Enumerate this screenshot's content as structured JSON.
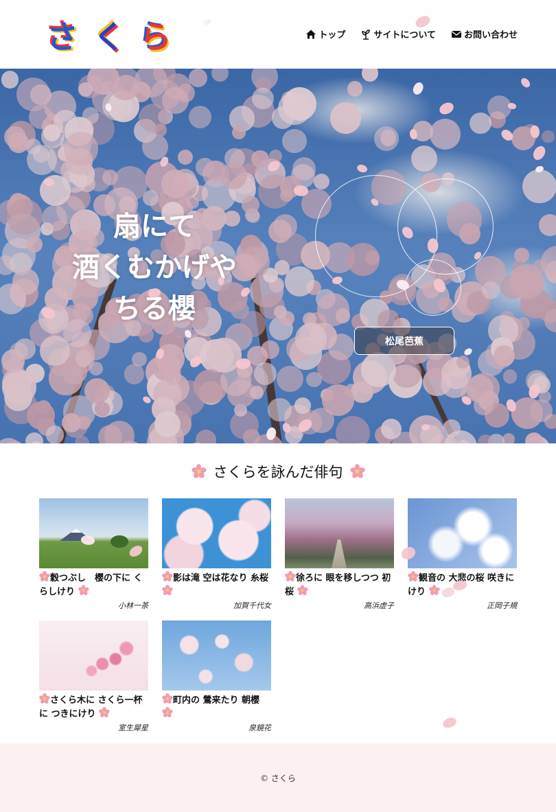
{
  "logo": {
    "text": "さくら",
    "chars": [
      "さ",
      "く",
      "ら"
    ]
  },
  "nav": {
    "items": [
      {
        "label": "トップ",
        "icon": "home-icon"
      },
      {
        "label": "サイトについて",
        "icon": "sprout-icon"
      },
      {
        "label": "お問い合わせ",
        "icon": "mail-icon"
      }
    ]
  },
  "hero": {
    "haiku_lines": [
      "扇にて",
      "酒くむかげや",
      "ちる櫻"
    ],
    "author_button": "松尾芭蕉"
  },
  "section": {
    "title": "さくらを詠んだ俳句",
    "cards": [
      {
        "text": "穀つぶし　櫻の下に くらしけり",
        "poet": "小林一茶"
      },
      {
        "text": "影は滝 空は花なり 糸桜",
        "poet": "加賀千代女"
      },
      {
        "text": "徐ろに 眼を移しつつ 初桜",
        "poet": "高浜虚子"
      },
      {
        "text": "観音の 大悲の桜 咲きにけり",
        "poet": "正岡子規"
      },
      {
        "text": "さくら木に さくら一杯に つきにけり",
        "poet": "室生犀星"
      },
      {
        "text": "町内の 鶯来たり 朝櫻",
        "poet": "泉鏡花"
      }
    ]
  },
  "footer": {
    "copyright": "© さくら"
  },
  "colors": {
    "accent_pink": "#f6c6cf",
    "footer_bg": "#fdf0f0",
    "sky_blue": "#4a7dc2"
  }
}
